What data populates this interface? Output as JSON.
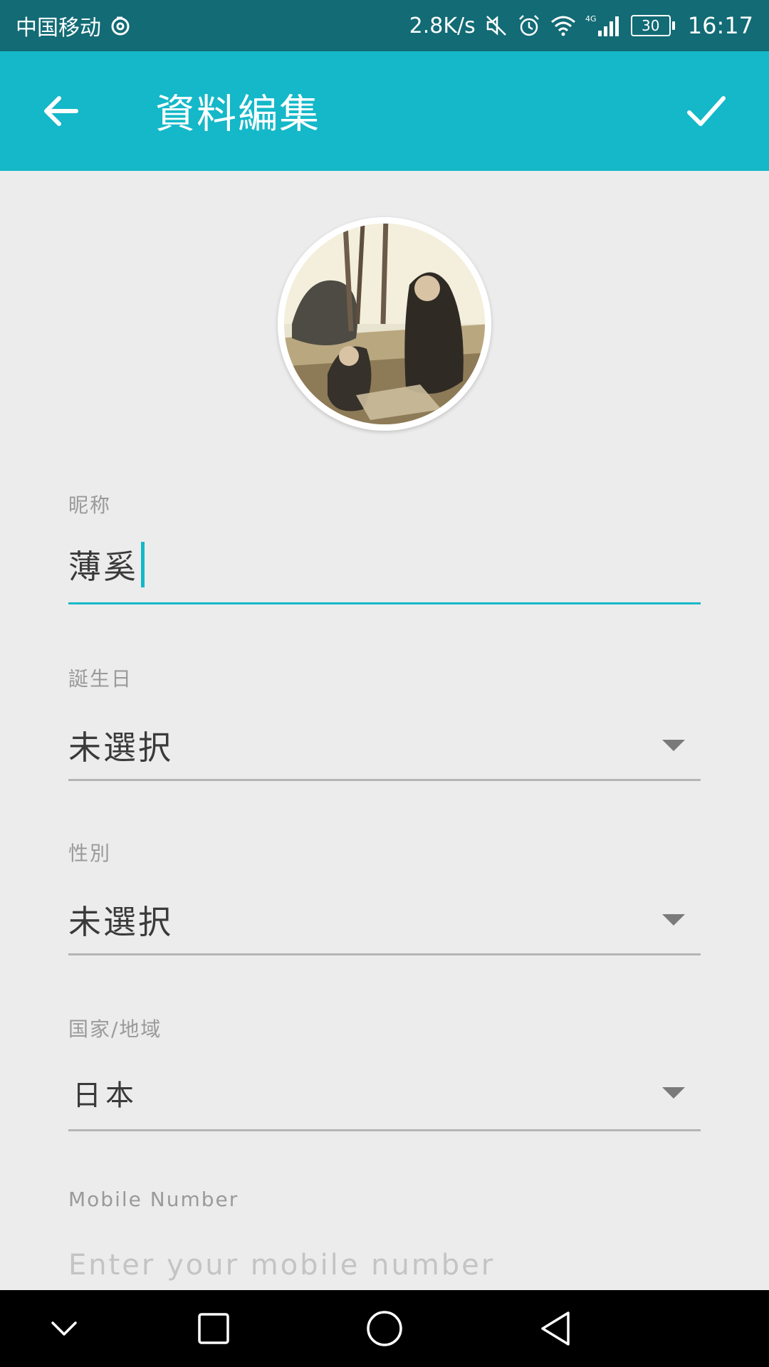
{
  "status_bar": {
    "carrier": "中国移动",
    "network_speed": "2.8K/s",
    "network_type": "4G",
    "battery": "30",
    "time": "16:17"
  },
  "app_bar": {
    "title": "資料編集"
  },
  "colors": {
    "accent": "#14b8c8",
    "status_bar": "#126b75",
    "background": "#ececec"
  },
  "form": {
    "nickname": {
      "label": "昵称",
      "value": "薄奚"
    },
    "birthday": {
      "label": "誕生日",
      "value": "未選択"
    },
    "gender": {
      "label": "性別",
      "value": "未選択"
    },
    "country": {
      "label": "国家/地域",
      "value": "日本"
    },
    "mobile": {
      "label": "Mobile Number",
      "value": "",
      "placeholder": "Enter your mobile number"
    }
  }
}
